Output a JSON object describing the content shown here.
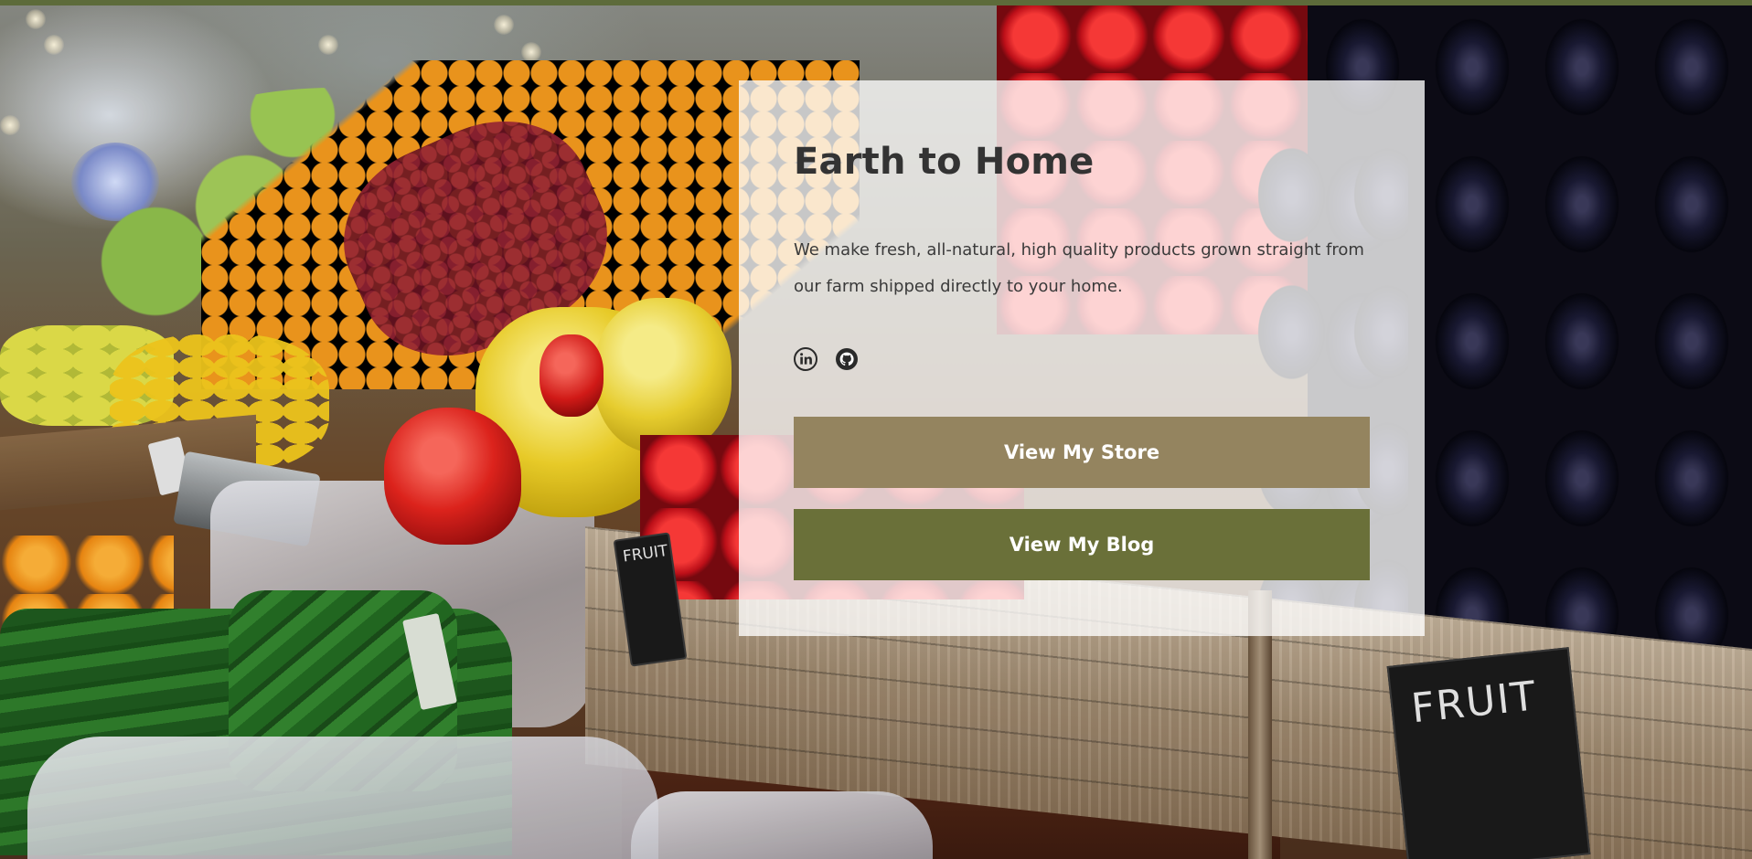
{
  "hero": {
    "title": "Earth to Home",
    "description": "We make fresh, all-natural, high quality products grown straight from our farm shipped directly to your home.",
    "social": [
      {
        "name": "linkedin-icon"
      },
      {
        "name": "github-icon"
      }
    ],
    "buttons": {
      "store_label": "View My Store",
      "blog_label": "View My Blog"
    }
  },
  "background": {
    "chalk_tag_small": "FRUIT",
    "chalk_tag_large": "FRUIT"
  },
  "colors": {
    "top_strip": "#5d6b3a",
    "store_button": "#94845f",
    "blog_button": "#6a7039",
    "title_text": "#333333",
    "card_background": "rgba(255,255,255,0.78)"
  }
}
